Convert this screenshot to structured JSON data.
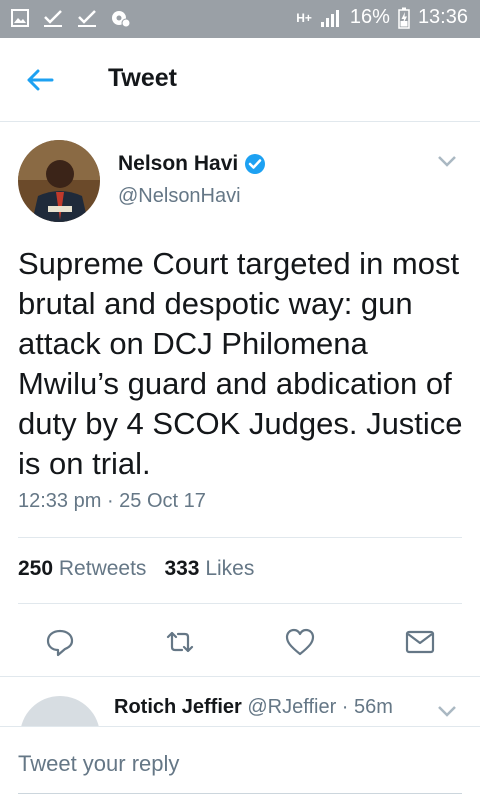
{
  "status_bar": {
    "network": "H+",
    "battery": "16%",
    "time": "13:36",
    "icons": [
      "image-icon",
      "check-icon",
      "check-icon",
      "settings-icon"
    ]
  },
  "app_bar": {
    "title": "Tweet",
    "back_icon": "arrow-left-icon"
  },
  "tweet": {
    "author_name": "Nelson Havi",
    "author_handle": "@NelsonHavi",
    "text": "Supreme Court targeted in most brutal and despotic way: gun attack on DCJ Philomena Mwilu’s guard and abdication of duty by 4 SCOK Judges. Justice is on trial.",
    "timestamp": "12:33 pm · 25 Oct 17",
    "retweets_count": "250",
    "retweets_label": "Retweets",
    "likes_count": "333",
    "likes_label": "Likes"
  },
  "reply_preview": {
    "name": "Rotich Jeffier",
    "handle_time": "@RJeffier · 56m"
  },
  "reply_box": {
    "placeholder": "Tweet your reply"
  },
  "colors": {
    "accent": "#1da1f2",
    "muted": "#657786",
    "status_bar": "#9aa0a6"
  }
}
